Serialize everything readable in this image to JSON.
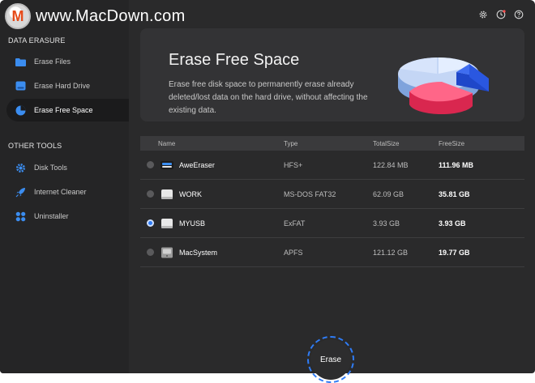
{
  "watermark": {
    "logo_letter": "M",
    "text": "www.MacDown.com"
  },
  "sidebar": {
    "section1": "DATA ERASURE",
    "section2": "OTHER TOOLS",
    "items": [
      {
        "label": "Erase Files",
        "icon": "folder-icon",
        "active": false
      },
      {
        "label": "Erase Hard Drive",
        "icon": "hard-drive-icon",
        "active": false
      },
      {
        "label": "Erase Free Space",
        "icon": "pie-chart-icon",
        "active": true
      }
    ],
    "tools": [
      {
        "label": "Disk Tools",
        "icon": "gear-icon"
      },
      {
        "label": "Internet Cleaner",
        "icon": "rocket-icon"
      },
      {
        "label": "Uninstaller",
        "icon": "apps-icon"
      }
    ]
  },
  "topbar": {
    "icons": [
      "settings-icon",
      "clock-icon",
      "help-icon"
    ]
  },
  "banner": {
    "title": "Erase Free Space",
    "description": "Erase free disk space to permanently erase already deleted/lost data on the hard drive, without affecting the existing data."
  },
  "table": {
    "headers": {
      "name": "Name",
      "type": "Type",
      "total": "TotalSize",
      "free": "FreeSize"
    },
    "rows": [
      {
        "name": "AweEraser",
        "type": "HFS+",
        "total": "122.84 MB",
        "free": "111.96 MB",
        "selected": false
      },
      {
        "name": "WORK",
        "type": "MS-DOS FAT32",
        "total": "62.09 GB",
        "free": "35.81 GB",
        "selected": false
      },
      {
        "name": "MYUSB",
        "type": "ExFAT",
        "total": "3.93 GB",
        "free": "3.93 GB",
        "selected": true
      },
      {
        "name": "MacSystem",
        "type": "APFS",
        "total": "121.12 GB",
        "free": "19.77 GB",
        "selected": false
      }
    ]
  },
  "actions": {
    "erase_label": "Erase"
  },
  "colors": {
    "accent": "#2f7cf6",
    "background": "#2a2a2b",
    "sidebar": "#252526"
  }
}
